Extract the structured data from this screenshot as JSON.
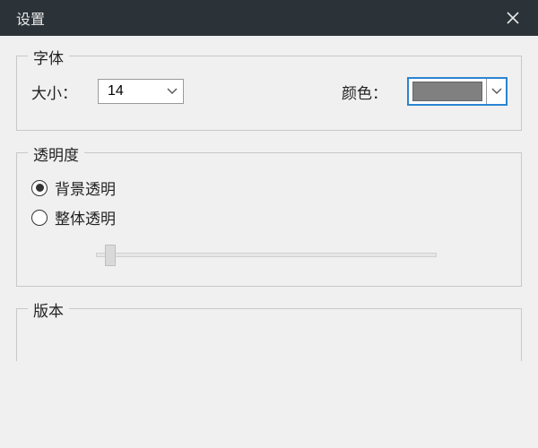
{
  "window": {
    "title": "设置"
  },
  "font": {
    "legend": "字体",
    "size_label": "大小：",
    "size_value": "14",
    "color_label": "颜色：",
    "color_value": "#808080"
  },
  "transparency": {
    "legend": "透明度",
    "option_bg": "背景透明",
    "option_whole": "整体透明",
    "selected": "bg",
    "slider_value": 5
  },
  "version": {
    "legend": "版本"
  }
}
